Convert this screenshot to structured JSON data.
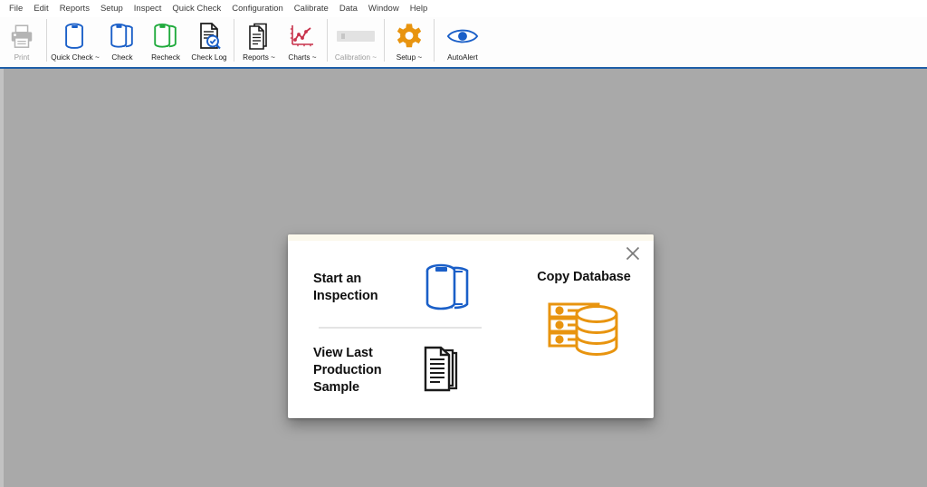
{
  "menubar": {
    "items": [
      {
        "label": "File"
      },
      {
        "label": "Edit"
      },
      {
        "label": "Reports"
      },
      {
        "label": "Setup"
      },
      {
        "label": "Inspect"
      },
      {
        "label": "Quick Check"
      },
      {
        "label": "Configuration"
      },
      {
        "label": "Calibrate"
      },
      {
        "label": "Data"
      },
      {
        "label": "Window"
      },
      {
        "label": "Help"
      }
    ]
  },
  "toolbar": {
    "buttons": [
      {
        "label": "Print",
        "icon": "printer-icon",
        "enabled": false
      },
      {
        "label": "Quick Check ~",
        "icon": "can-single-icon",
        "enabled": true
      },
      {
        "label": "Check",
        "icon": "can-stack-icon",
        "enabled": true
      },
      {
        "label": "Recheck",
        "icon": "can-stack-green-icon",
        "enabled": true
      },
      {
        "label": "Check Log",
        "icon": "document-search-icon",
        "enabled": true
      },
      {
        "label": "Reports ~",
        "icon": "documents-icon",
        "enabled": true
      },
      {
        "label": "Charts ~",
        "icon": "line-chart-icon",
        "enabled": true
      },
      {
        "label": "Calibration ~",
        "icon": "calibration-bar-icon",
        "enabled": false
      },
      {
        "label": "Setup ~",
        "icon": "gear-icon",
        "enabled": true
      },
      {
        "label": "AutoAlert",
        "icon": "eye-icon",
        "enabled": true
      }
    ]
  },
  "modal": {
    "close_icon": "close-icon",
    "options": [
      {
        "label": "Start an Inspection",
        "icon": "can-stack-blue-icon"
      },
      {
        "label": "View Last\nProduction Sample",
        "line1": "View Last",
        "line2": "Production Sample",
        "icon": "documents-stack-icon"
      },
      {
        "label": "Copy Database",
        "icon": "database-copy-icon"
      }
    ]
  },
  "colors": {
    "blue": "#1a5fc8",
    "green": "#1faa3c",
    "orange": "#e8940f",
    "red": "#c8324b",
    "gray_disabled": "#b4b4b4",
    "ribbon_accent": "#1f5fa8",
    "workarea_bg": "#a9a9a9"
  }
}
